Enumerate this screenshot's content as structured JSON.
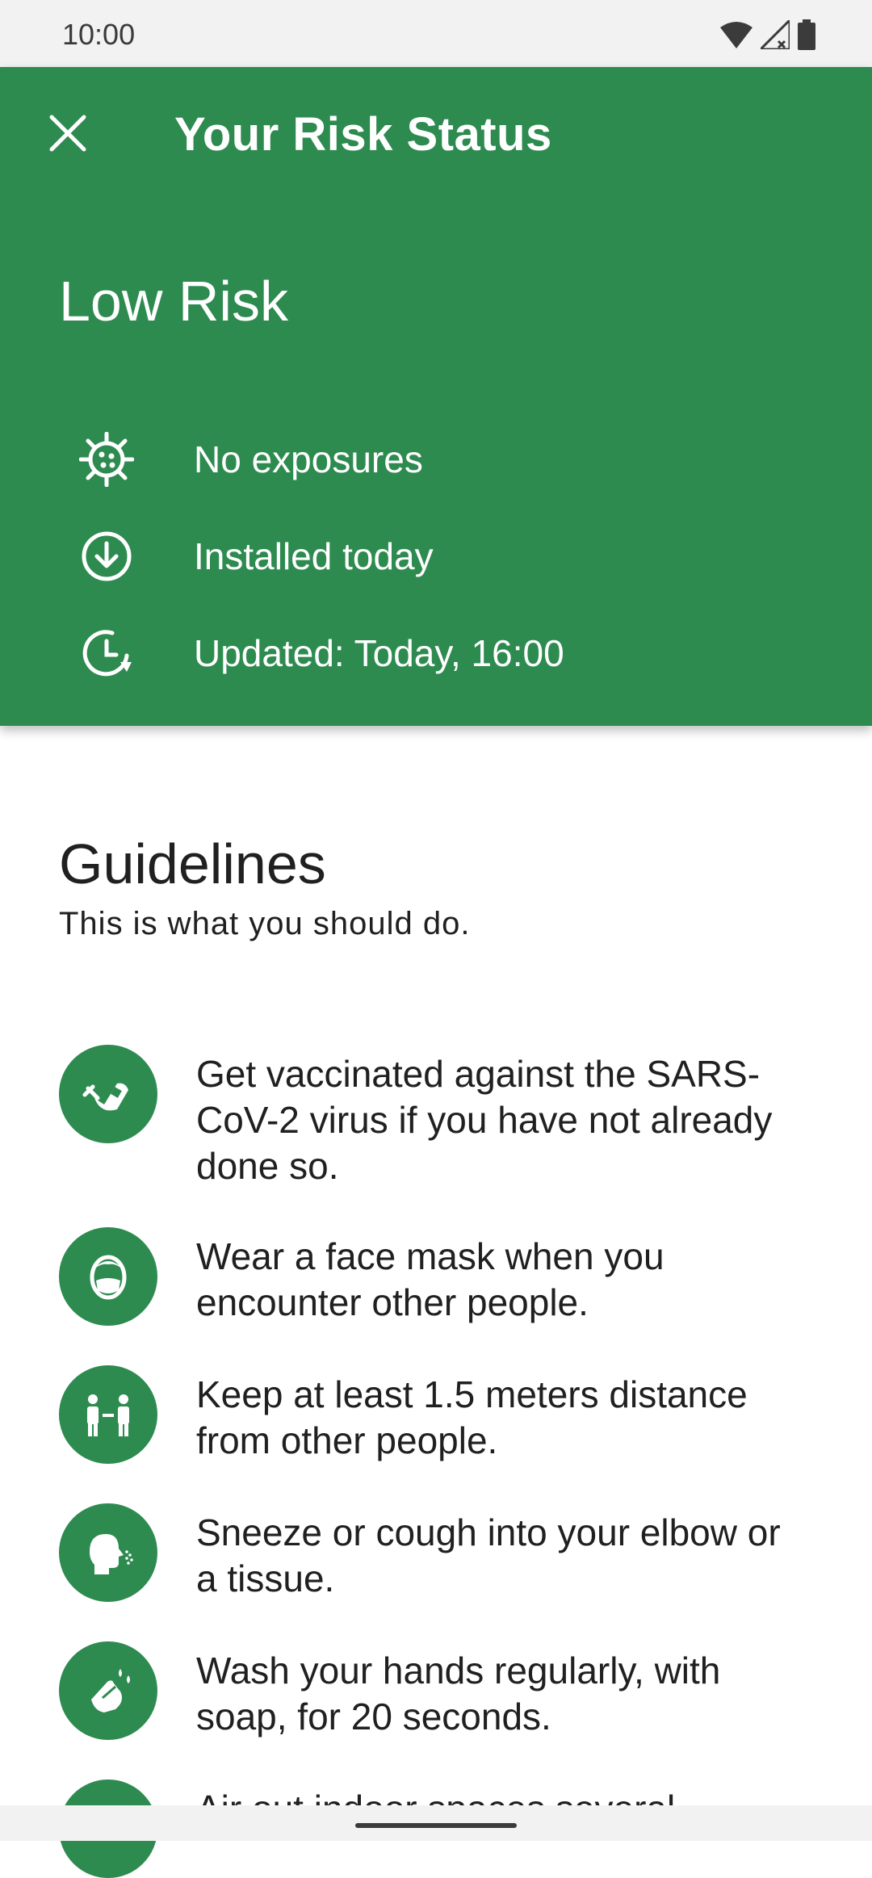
{
  "status_bar": {
    "time": "10:00"
  },
  "header": {
    "title": "Your Risk Status",
    "risk_level": "Low Risk",
    "rows": [
      {
        "icon": "virus-icon",
        "text": "No exposures"
      },
      {
        "icon": "download-icon",
        "text": "Installed today"
      },
      {
        "icon": "clock-refresh-icon",
        "text": "Updated: Today, 16:00"
      }
    ]
  },
  "guidelines": {
    "title": "Guidelines",
    "subtitle": "This is what you should do.",
    "items": [
      {
        "icon": "vaccine-icon",
        "text": "Get vaccinated against the SARS-CoV-2 virus if you have not already done so."
      },
      {
        "icon": "face-mask-icon",
        "text": "Wear a face mask when you encounter other people."
      },
      {
        "icon": "distance-icon",
        "text": "Keep at least 1.5 meters distance from other people."
      },
      {
        "icon": "sneeze-icon",
        "text": "Sneeze or cough into your elbow or a tissue."
      },
      {
        "icon": "wash-hands-icon",
        "text": "Wash your hands regularly, with soap, for 20 seconds."
      },
      {
        "icon": "ventilation-icon",
        "text": "Air out indoor spaces several"
      }
    ]
  },
  "colors": {
    "header_green": "#2e8b50",
    "text_dark": "#202020"
  }
}
